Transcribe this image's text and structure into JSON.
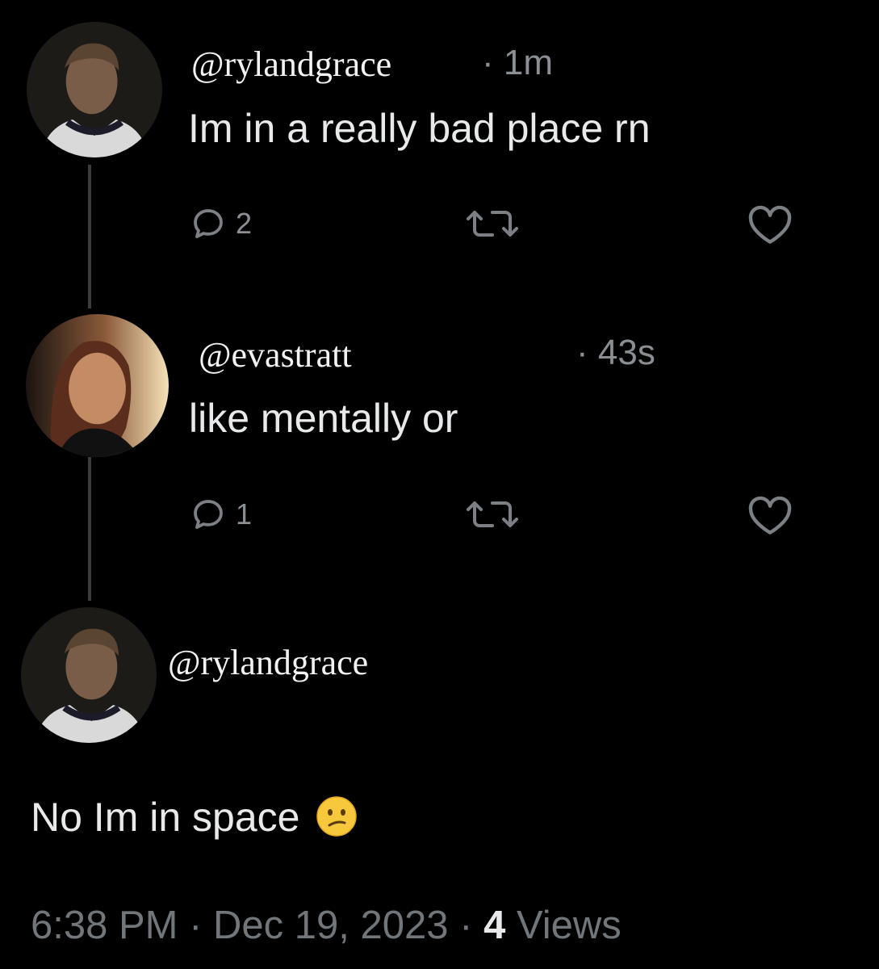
{
  "posts": [
    {
      "handle": "@rylandgrace",
      "time": "· 1m",
      "text": "Im in a really bad place rn",
      "replies": "2"
    },
    {
      "handle": "@evastratt",
      "time": "· 43s",
      "text": "like mentally or",
      "replies": "1"
    },
    {
      "handle": "@rylandgrace",
      "text": "No Im in space"
    }
  ],
  "footer": {
    "time": "6:38 PM",
    "sep1": " · ",
    "date": "Dec 19, 2023",
    "sep2": " · ",
    "views_count": "4",
    "views_label": " Views"
  },
  "icons": {
    "reply": "reply-icon",
    "repost": "repost-icon",
    "like": "heart-icon",
    "emoji": "confused-face-emoji"
  },
  "colors": {
    "background": "#000000",
    "text": "#e7e9ea",
    "muted": "#71767b",
    "thread_line": "#3a3d40"
  }
}
